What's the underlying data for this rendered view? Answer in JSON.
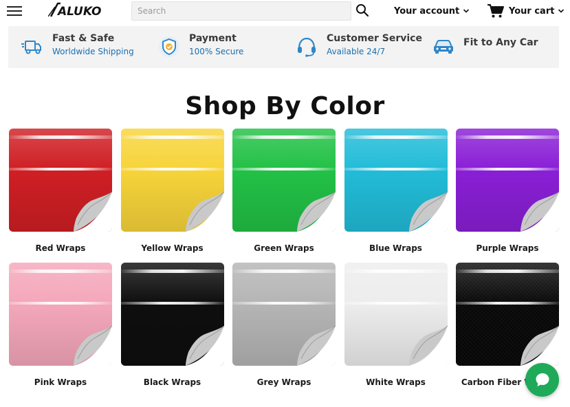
{
  "header": {
    "logo_text": "ALUKO",
    "search_placeholder": "Search",
    "account_label": "Your account",
    "cart_label": "Your cart"
  },
  "features": [
    {
      "icon": "shipping-truck-icon",
      "title": "Fast & Safe",
      "subtitle": "Worldwide Shipping"
    },
    {
      "icon": "shield-check-icon",
      "title": "Payment",
      "subtitle": "100% Secure"
    },
    {
      "icon": "headset-icon",
      "title": "Customer Service",
      "subtitle": "Available 24/7"
    },
    {
      "icon": "car-icon",
      "title": "Fit to Any Car"
    }
  ],
  "section_title": "Shop By Color",
  "colors": [
    {
      "label": "Red Wraps",
      "color": "#cf1f24"
    },
    {
      "label": "Yellow Wraps",
      "color": "#f7d43a"
    },
    {
      "label": "Green Wraps",
      "color": "#22c146"
    },
    {
      "label": "Blue Wraps",
      "color": "#22bcd8"
    },
    {
      "label": "Purple Wraps",
      "color": "#8a1fd6"
    },
    {
      "label": "Pink Wraps",
      "color": "#f4a7ba"
    },
    {
      "label": "Black Wraps",
      "color": "#0e0e0e"
    },
    {
      "label": "Grey Wraps",
      "color": "#b5b5b5"
    },
    {
      "label": "White Wraps",
      "color": "#ededed"
    },
    {
      "label": "Carbon Fiber Wraps",
      "color": "#3a3a3a"
    }
  ],
  "chat_icon": "chat-bubble-icon",
  "accent_color": "#1a6fb0"
}
